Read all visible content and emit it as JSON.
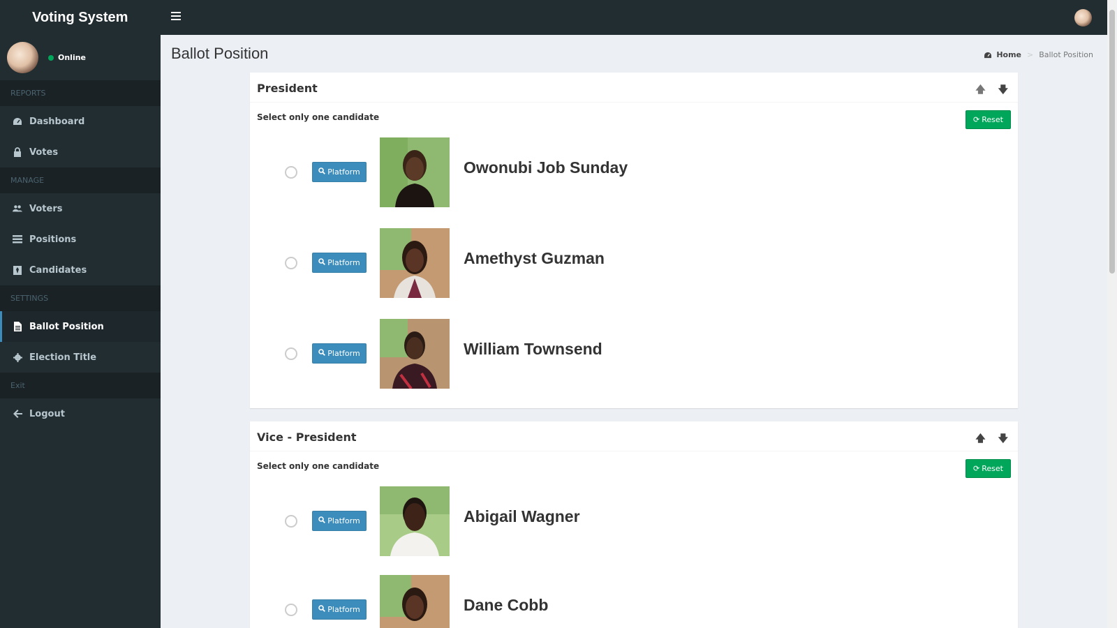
{
  "app": {
    "title": "Voting System"
  },
  "user": {
    "status": "Online"
  },
  "sidebar": {
    "sections": [
      {
        "header": "REPORTS",
        "items": [
          {
            "label": "Dashboard",
            "icon": "dashboard-icon"
          },
          {
            "label": "Votes",
            "icon": "lock-icon"
          }
        ]
      },
      {
        "header": "MANAGE",
        "items": [
          {
            "label": "Voters",
            "icon": "users-icon"
          },
          {
            "label": "Positions",
            "icon": "tasks-icon"
          },
          {
            "label": "Candidates",
            "icon": "black-tie-icon"
          }
        ]
      },
      {
        "header": "SETTINGS",
        "items": [
          {
            "label": "Ballot Position",
            "icon": "file-text-icon",
            "active": true
          },
          {
            "label": "Election Title",
            "icon": "cog-icon"
          }
        ]
      },
      {
        "header": "Exit",
        "items": [
          {
            "label": "Logout",
            "icon": "arrow-left-icon"
          }
        ]
      }
    ]
  },
  "page": {
    "title": "Ballot Position",
    "breadcrumb": {
      "home": "Home",
      "current": "Ballot Position"
    }
  },
  "positions": [
    {
      "title": "President",
      "instruction": "Select only one candidate",
      "reset_label": "Reset",
      "candidates": [
        {
          "name": "Owonubi Job Sunday",
          "platform_label": "Platform"
        },
        {
          "name": "Amethyst Guzman",
          "platform_label": "Platform"
        },
        {
          "name": "William Townsend",
          "platform_label": "Platform"
        }
      ]
    },
    {
      "title": "Vice - President",
      "instruction": "Select only one candidate",
      "reset_label": "Reset",
      "candidates": [
        {
          "name": "Abigail Wagner",
          "platform_label": "Platform"
        },
        {
          "name": "Dane Cobb",
          "platform_label": "Platform"
        }
      ]
    }
  ],
  "colors": {
    "sidebar_bg": "#222d32",
    "accent": "#3c8dbc",
    "success": "#00a65a",
    "content_bg": "#ecf0f5"
  }
}
